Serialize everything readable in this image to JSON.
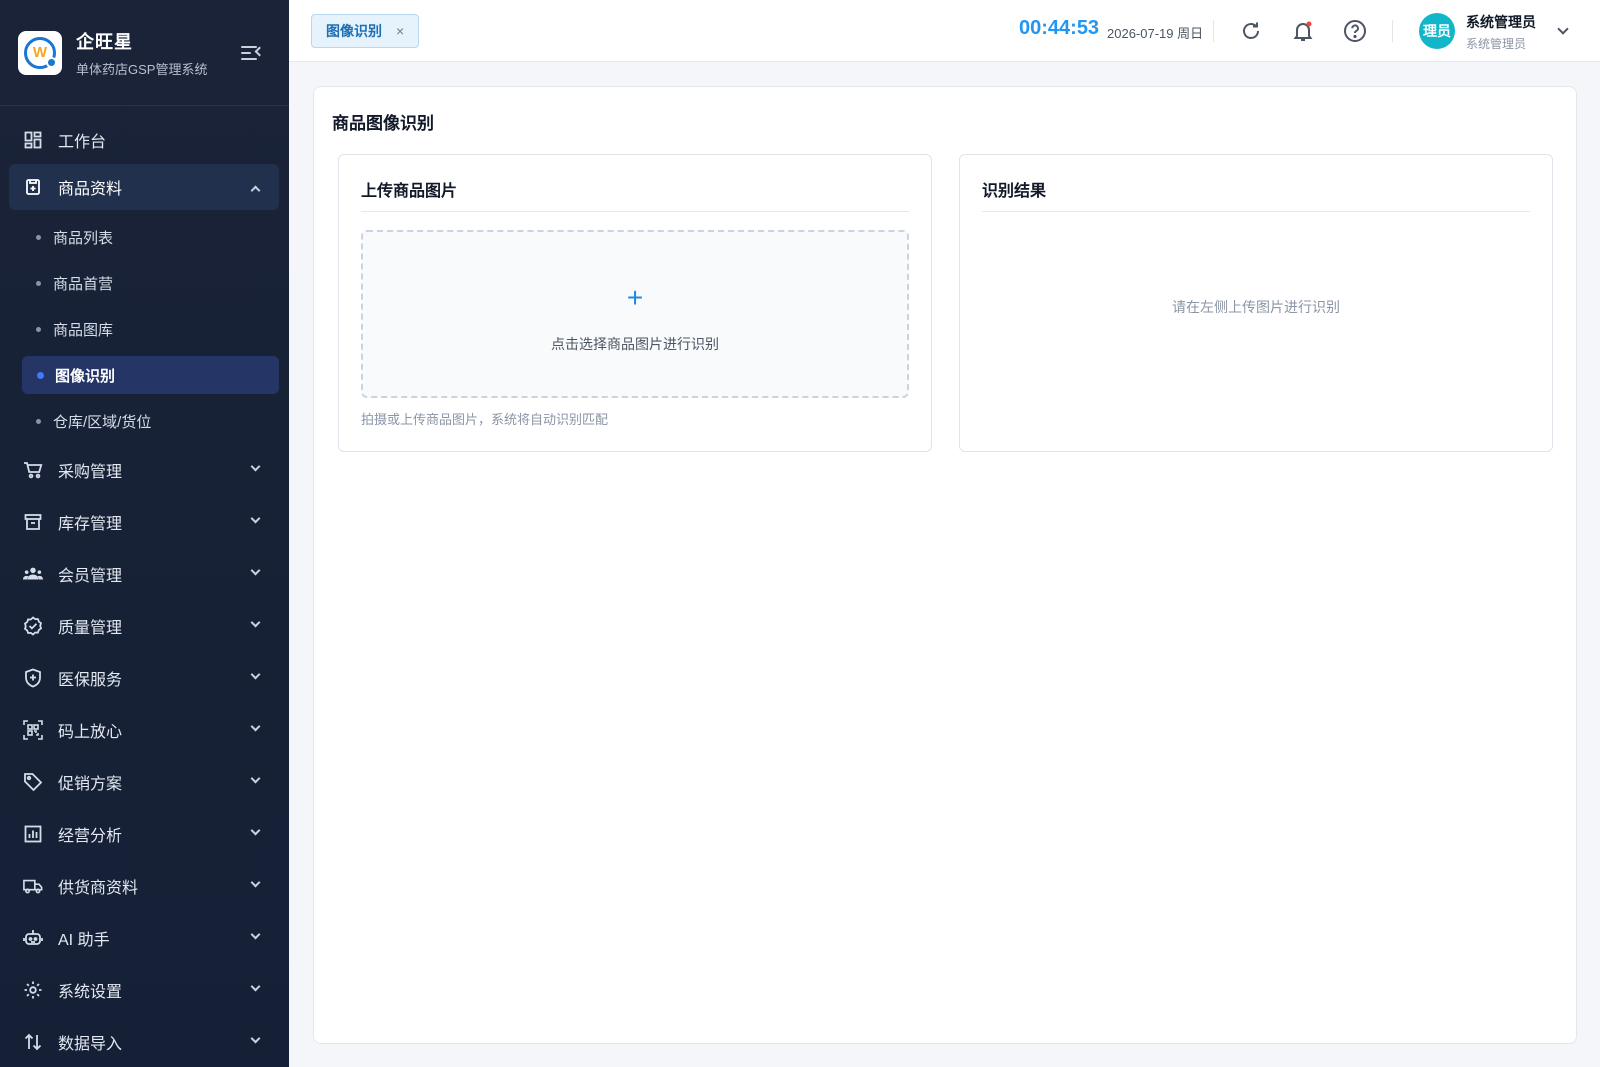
{
  "brand": {
    "name": "企旺星",
    "subtitle": "单体药店GSP管理系统",
    "logo_letter": "W"
  },
  "sidebar": {
    "items": [
      {
        "label": "工作台",
        "icon": "dashboard-icon"
      },
      {
        "label": "商品资料",
        "icon": "product-icon",
        "expanded": true,
        "children": [
          {
            "label": "商品列表"
          },
          {
            "label": "商品首营"
          },
          {
            "label": "商品图库"
          },
          {
            "label": "图像识别",
            "active": true
          },
          {
            "label": "仓库/区域/货位"
          }
        ]
      },
      {
        "label": "采购管理",
        "icon": "cart-icon"
      },
      {
        "label": "库存管理",
        "icon": "archive-icon"
      },
      {
        "label": "会员管理",
        "icon": "members-icon"
      },
      {
        "label": "质量管理",
        "icon": "badge-check-icon"
      },
      {
        "label": "医保服务",
        "icon": "shield-plus-icon"
      },
      {
        "label": "码上放心",
        "icon": "qrcode-scan-icon"
      },
      {
        "label": "促销方案",
        "icon": "tag-icon"
      },
      {
        "label": "经营分析",
        "icon": "bar-chart-icon"
      },
      {
        "label": "供货商资料",
        "icon": "truck-icon"
      },
      {
        "label": "AI 助手",
        "icon": "robot-icon"
      },
      {
        "label": "系统设置",
        "icon": "gear-icon"
      },
      {
        "label": "数据导入",
        "icon": "import-icon"
      }
    ]
  },
  "topbar": {
    "tab_label": "图像识别",
    "tab_close": "×",
    "clock": "00:44:53",
    "date": "2026-07-19 周日",
    "user_name": "系统管理员",
    "user_role": "系统管理员",
    "avatar_text": "理员"
  },
  "main": {
    "title": "商品图像识别",
    "upload_panel": {
      "title": "上传商品图片",
      "plus": "+",
      "dropzone_text": "点击选择商品图片进行识别",
      "hint": "拍摄或上传商品图片，系统将自动识别匹配"
    },
    "result_panel": {
      "title": "识别结果",
      "empty_text": "请在左侧上传图片进行识别"
    }
  },
  "colors": {
    "sidebar_bg": "#1a2337",
    "accent": "#2196f3",
    "active_sub_bg": "#243566",
    "avatar_bg": "#13b5c9"
  }
}
